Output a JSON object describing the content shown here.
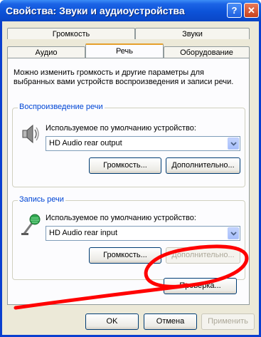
{
  "window": {
    "title": "Свойства: Звуки и аудиоустройства",
    "help_label": "?",
    "close_label": "✕"
  },
  "tabs": {
    "row1": [
      "Громкость",
      "Звуки"
    ],
    "row2": [
      "Аудио",
      "Речь",
      "Оборудование"
    ],
    "active": "Речь"
  },
  "description": {
    "line1": "Можно изменить громкость и другие параметры для",
    "line2": "выбранных вами устройств воспроизведения и записи речи."
  },
  "playback": {
    "group_title": "Воспроизведение речи",
    "device_label": "Используемое по умолчанию устройство:",
    "device_value": "HD Audio rear output",
    "volume_button": "Громкость...",
    "advanced_button": "Дополнительно..."
  },
  "recording": {
    "group_title": "Запись речи",
    "device_label": "Используемое по умолчанию устройство:",
    "device_value": "HD Audio rear input",
    "volume_button": "Громкость...",
    "advanced_button": "Дополнительно..."
  },
  "test_button": "Проверка...",
  "footer": {
    "ok": "OK",
    "cancel": "Отмена",
    "apply": "Применить"
  },
  "colors": {
    "annotation": "#ff0000",
    "group_title": "#0046d5",
    "title_bar": "#0a46c6"
  }
}
